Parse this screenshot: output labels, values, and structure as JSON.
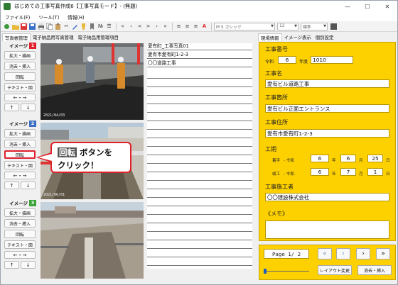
{
  "window": {
    "title": "はじめての工事写真作成6【工事写真モード】- (無題)"
  },
  "menu": [
    "ファイル(F)",
    "ツール(T)",
    "情報(H)"
  ],
  "toolbar": {
    "font": "M S ゴシック",
    "size": "12",
    "style": "標準",
    "no_label": "№"
  },
  "left_tabs": [
    "写真帳管理",
    "電子納品用写真管理",
    "電子納品用管理項目"
  ],
  "right_tabs": [
    "現場情報",
    "イメージ表示",
    "個別設定"
  ],
  "image_groups": [
    {
      "label": "イメージ",
      "number": "1",
      "color": "#e0202a",
      "buttons": [
        "拡大・描画",
        "消去・挿入",
        "回転",
        "テキスト・図"
      ],
      "date": "2021/04/03"
    },
    {
      "label": "イメージ",
      "number": "2",
      "color": "#3d6fc2",
      "buttons": [
        "拡大・描画",
        "消去・挿入",
        "回転",
        "テキスト・図"
      ],
      "date": "2021/06/01"
    },
    {
      "label": "イメージ",
      "number": "3",
      "color": "#3aa33a",
      "buttons": [
        "拡大・描画",
        "消去・挿入",
        "回転",
        "テキスト・図"
      ],
      "date": ""
    }
  ],
  "arrows": {
    "lr": "←・→",
    "up": "↑",
    "down": "↓"
  },
  "text_lines": [
    "愛有町_工事写真01",
    "愛有市愛有町1-2-3",
    "〇〇道路工事"
  ],
  "info": {
    "photo_no_label": "工事番号",
    "reiwa": "令和",
    "year": "6",
    "year_unit": "年度",
    "code": "1010",
    "name_label": "工事名",
    "name": "愛有ビル道路工事",
    "place_label": "工事箇所",
    "place": "愛有ビル正面エントランス",
    "address_label": "工事住所",
    "address": "愛有市愛有町1-2-3",
    "period_label": "工期",
    "start_label": "着手",
    "end_label": "竣工",
    "start": {
      "era": "- 令和",
      "y": "6",
      "m": "6",
      "d": "25"
    },
    "end": {
      "era": "- 令和",
      "y": "6",
      "m": "7",
      "d": "1"
    },
    "y_unit": "年",
    "m_unit": "月",
    "d_unit": "日",
    "contractor_label": "工事施工者",
    "contractor": "〇〇建設株式会社",
    "memo_label": "《メモ》"
  },
  "nav": {
    "page": "Page 1/ 2",
    "layout_btn": "レイアウト変更",
    "erase_btn": "消去・挿入"
  },
  "callout": {
    "chip": "回転",
    "line1_rest": " ボタンを",
    "line2": "クリック！"
  }
}
